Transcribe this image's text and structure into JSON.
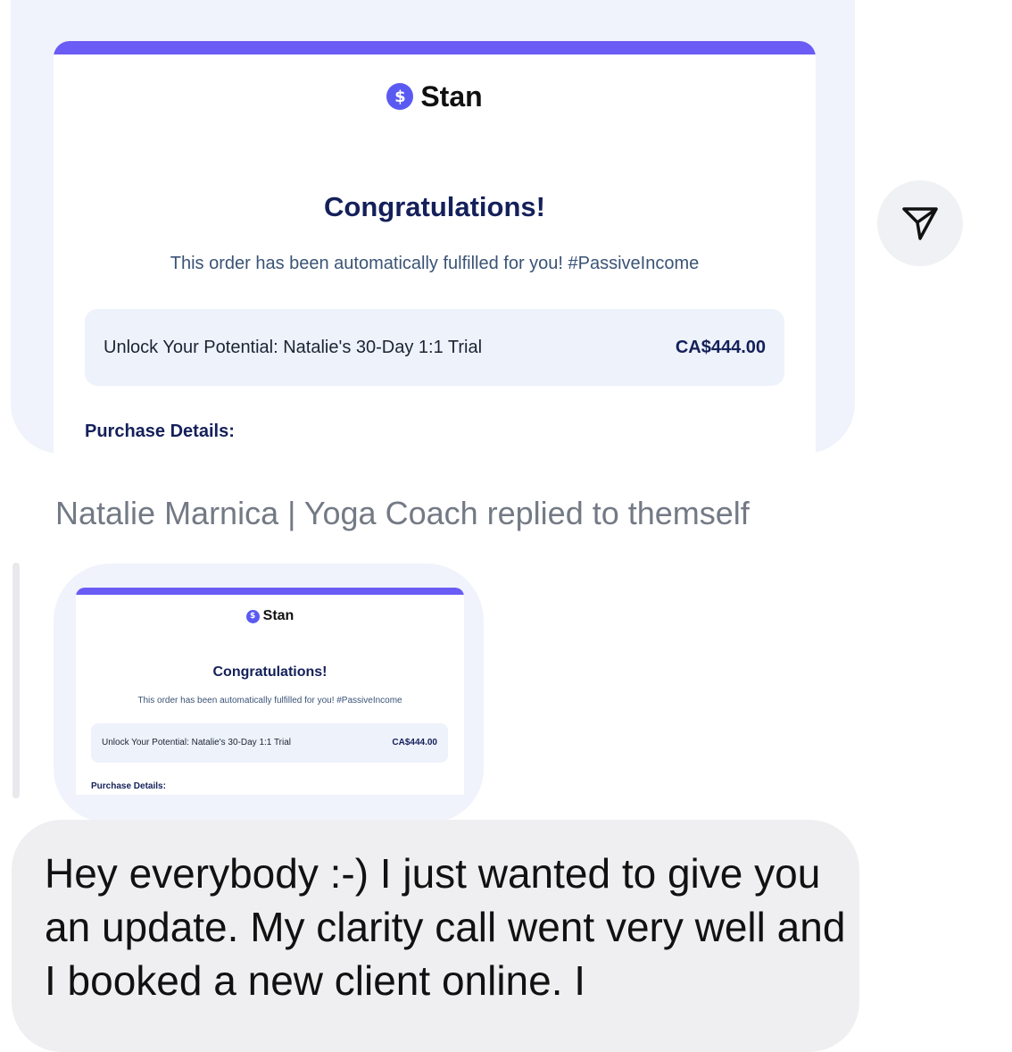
{
  "shared_email": {
    "brand": "Stan",
    "brand_icon": "dollar-coin-icon",
    "accent_color": "#6a5cf5",
    "headline": "Congratulations!",
    "subline": "This order has been automatically fulfilled for you! #PassiveIncome",
    "product_name": "Unlock Your Potential: Natalie's 30-Day 1:1 Trial",
    "product_price": "CA$444.00",
    "details_label": "Purchase Details:"
  },
  "send_button": {
    "icon": "send-paper-plane-icon"
  },
  "reply": {
    "label": "Natalie Marnica | Yoga Coach replied to themself"
  },
  "message": {
    "text": "Hey everybody :-) I just wanted to give you an update. My clarity call went very well and I booked a new client online. I"
  }
}
